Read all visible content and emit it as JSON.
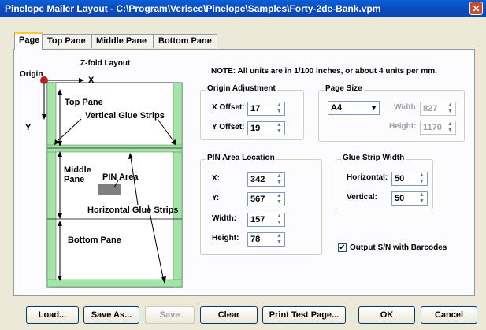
{
  "window": {
    "title": "Pinelope Mailer Layout - C:\\Program\\Verisec\\Pinelope\\Samples\\Forty-2de-Bank.vpm",
    "close_glyph": "✕"
  },
  "tabs": [
    "Page",
    "Top Pane",
    "Middle Pane",
    "Bottom Pane"
  ],
  "diagram": {
    "title": "Z-fold Layout",
    "origin": "Origin",
    "x_axis": "X",
    "y_axis": "Y",
    "top_pane": "Top Pane",
    "vertical_glue": "Vertical Glue Strips",
    "middle_pane_l1": "Middle",
    "middle_pane_l2": "Pane",
    "pin_area": "PIN Area",
    "horizontal_glue": "Horizontal Glue Strips",
    "bottom_pane": "Bottom Pane",
    "colors": {
      "glue": "#a6e3a6",
      "pin": "#7f7f7f",
      "origin": "#b22222"
    }
  },
  "note": "NOTE: All units are in 1/100 inches, or about 4 units per mm.",
  "origin_adjustment": {
    "title": "Origin Adjustment",
    "x_label": "X Offset:",
    "x_value": "17",
    "y_label": "Y Offset:",
    "y_value": "19"
  },
  "page_size": {
    "title": "Page Size",
    "selected": "A4",
    "width_label": "Width:",
    "width_value": "827",
    "height_label": "Height:",
    "height_value": "1170"
  },
  "pin_area_location": {
    "title": "PIN Area Location",
    "x_label": "X:",
    "x_value": "342",
    "y_label": "Y:",
    "y_value": "567",
    "width_label": "Width:",
    "width_value": "157",
    "height_label": "Height:",
    "height_value": "78"
  },
  "glue_strip_width": {
    "title": "Glue Strip Width",
    "horizontal_label": "Horizontal:",
    "horizontal_value": "50",
    "vertical_label": "Vertical:",
    "vertical_value": "50"
  },
  "output_sn": {
    "label": "Output S/N with Barcodes",
    "checked": "✔"
  },
  "buttons": {
    "load": "Load...",
    "save_as": "Save As...",
    "save": "Save",
    "clear": "Clear",
    "print_test": "Print Test Page...",
    "ok": "OK",
    "cancel": "Cancel"
  }
}
